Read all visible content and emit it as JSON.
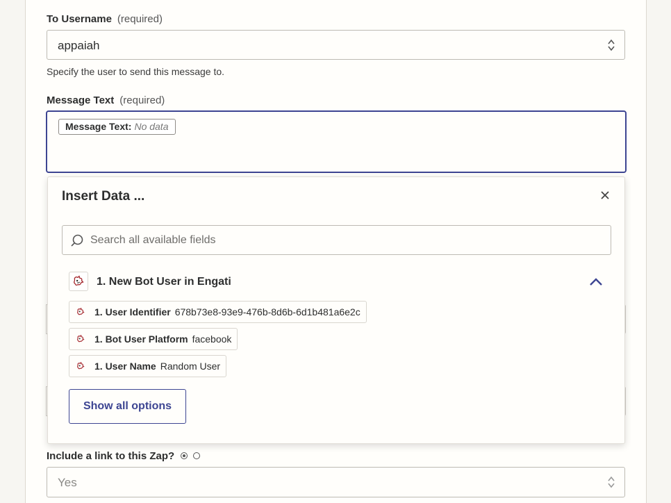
{
  "to_username": {
    "label": "To Username",
    "required": "(required)",
    "value": "appaiah",
    "help": "Specify the user to send this message to."
  },
  "message_text": {
    "label": "Message Text",
    "required": "(required)",
    "pill_label": "Message Text:",
    "pill_value": "No data"
  },
  "insert_data": {
    "title": "Insert Data ...",
    "search_placeholder": "Search all available fields",
    "group_title": "1. New Bot User in Engati",
    "options": [
      {
        "label": "1. User Identifier",
        "value": "678b73e8-93e9-476b-8d6b-6d1b481a6e2c"
      },
      {
        "label": "1. Bot User Platform",
        "value": "facebook"
      },
      {
        "label": "1. User Name",
        "value": "Random User"
      }
    ],
    "show_all_label": "Show all options"
  },
  "include_link": {
    "label": "Include a link to this Zap?",
    "value": "Yes"
  },
  "colors": {
    "accent": "#3d4592",
    "app_icon": "#a4262c"
  }
}
